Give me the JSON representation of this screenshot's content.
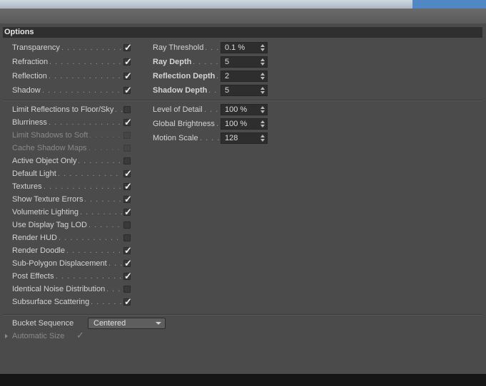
{
  "options": {
    "header": "Options",
    "left_group1": [
      {
        "label": "Transparency",
        "checked": true
      },
      {
        "label": "Refraction",
        "checked": true
      },
      {
        "label": "Reflection",
        "checked": true
      },
      {
        "label": "Shadow",
        "checked": true
      }
    ],
    "right_group1": [
      {
        "label": "Ray Threshold",
        "value": "0.1 %",
        "bold": false
      },
      {
        "label": "Ray Depth",
        "value": "5",
        "bold": true
      },
      {
        "label": "Reflection Depth",
        "value": "2",
        "bold": true
      },
      {
        "label": "Shadow Depth",
        "value": "5",
        "bold": true
      }
    ],
    "left_group2": [
      {
        "label": "Limit Reflections to Floor/Sky",
        "checked": false,
        "disabled": false
      },
      {
        "label": "Blurriness",
        "checked": true,
        "disabled": false
      },
      {
        "label": "Limit Shadows to Soft",
        "checked": false,
        "disabled": true
      },
      {
        "label": "Cache Shadow Maps",
        "checked": false,
        "disabled": true
      },
      {
        "label": "Active Object Only",
        "checked": false,
        "disabled": false
      },
      {
        "label": "Default Light",
        "checked": true,
        "disabled": false
      },
      {
        "label": "Textures",
        "checked": true,
        "disabled": false
      },
      {
        "label": "Show Texture Errors",
        "checked": true,
        "disabled": false
      },
      {
        "label": "Volumetric Lighting",
        "checked": true,
        "disabled": false
      },
      {
        "label": "Use Display Tag LOD",
        "checked": false,
        "disabled": false
      },
      {
        "label": "Render HUD",
        "checked": false,
        "disabled": false
      },
      {
        "label": "Render Doodle",
        "checked": true,
        "disabled": false
      },
      {
        "label": "Sub-Polygon Displacement",
        "checked": true,
        "disabled": false
      },
      {
        "label": "Post Effects",
        "checked": true,
        "disabled": false
      },
      {
        "label": "Identical Noise Distribution",
        "checked": false,
        "disabled": false
      },
      {
        "label": "Subsurface Scattering",
        "checked": true,
        "disabled": false
      }
    ],
    "right_group2": [
      {
        "label": "Level of Detail",
        "value": "100 %"
      },
      {
        "label": "Global Brightness",
        "value": "100 %"
      },
      {
        "label": "Motion Scale",
        "value": "128"
      }
    ],
    "bucket_sequence": {
      "label": "Bucket Sequence",
      "value": "Centered"
    },
    "automatic_size": {
      "label": "Automatic Size",
      "checked": true,
      "disabled": true
    }
  },
  "colors": {
    "panel_bg": "#4b4b4b",
    "header_bg": "#2f2f2f",
    "field_bg": "#2e2e2e",
    "text": "#d4d4d4",
    "disabled_text": "#8a8a8a"
  },
  "icons": {
    "check": "check-icon",
    "spinner": "spinner-arrows-icon",
    "dropdown": "chevron-down-icon",
    "expander": "expand-triangle-icon"
  }
}
